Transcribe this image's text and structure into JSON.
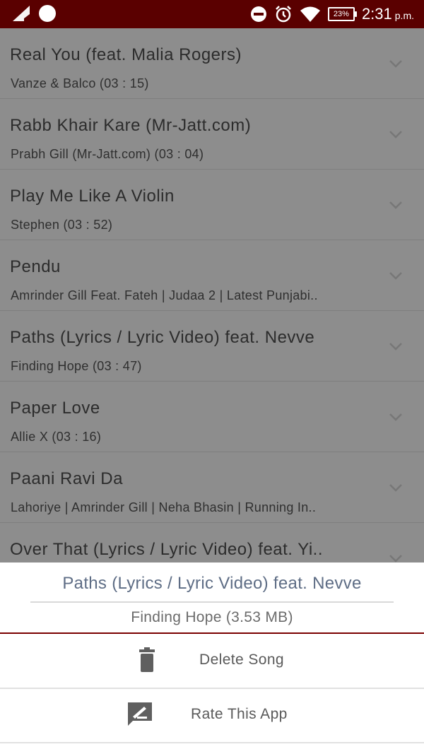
{
  "status_bar": {
    "time": "2:31",
    "ampm": "p.m.",
    "battery_percent": "23%",
    "icons": [
      "signal-icon",
      "notification-dot-icon",
      "do-not-disturb-icon",
      "alarm-icon",
      "wifi-icon",
      "battery-icon"
    ]
  },
  "songs": [
    {
      "title": "Real You (feat. Malia Rogers)",
      "subtitle": "Vanze & Balco (03 : 15)"
    },
    {
      "title": "Rabb Khair Kare (Mr-Jatt.com)",
      "subtitle": "Prabh Gill (Mr-Jatt.com) (03 : 04)"
    },
    {
      "title": "Play Me Like A Violin",
      "subtitle": "Stephen (03 : 52)"
    },
    {
      "title": "Pendu",
      "subtitle": "Amrinder Gill Feat. Fateh | Judaa 2 | Latest Punjabi.."
    },
    {
      "title": "Paths (Lyrics / Lyric Video) feat. Nevve",
      "subtitle": "Finding Hope (03 : 47)"
    },
    {
      "title": "Paper Love",
      "subtitle": "Allie X (03 : 16)"
    },
    {
      "title": "Paani Ravi Da",
      "subtitle": "Lahoriye | Amrinder Gill | Neha Bhasin | Running In.."
    },
    {
      "title": "Over That (Lyrics / Lyric Video) feat. Yi..",
      "subtitle": ""
    }
  ],
  "sheet": {
    "title": "Paths (Lyrics / Lyric Video) feat. Nevve",
    "subtitle": "Finding Hope (3.53 MB)",
    "actions": [
      {
        "label": "Delete Song",
        "icon": "trash-icon"
      },
      {
        "label": "Rate This App",
        "icon": "rate-icon"
      }
    ]
  },
  "colors": {
    "status_bar": "#5a0000",
    "accent": "#7a0000",
    "overlay_list": "#8d8d8d",
    "sheet_title": "#5e6d85"
  }
}
